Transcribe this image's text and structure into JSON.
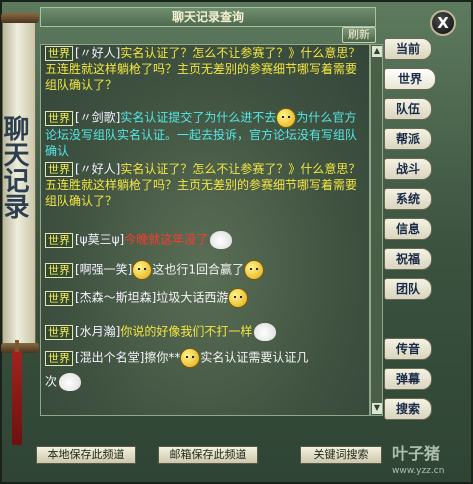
{
  "window": {
    "title": "聊天记录查询",
    "refresh_label": "刷新",
    "close_label": "X"
  },
  "scroll_banner": "聊天记录",
  "messages": [
    {
      "channel": "世界",
      "name": "[〃好人]",
      "text": "实名认证了？怎么不让参赛了？》什么意思？五连胜就这样躺枪了吗？主页无差别的参赛细节哪写着需要组队确认了？",
      "color": "yellow"
    },
    {
      "channel": "世界",
      "name": "[〃剑歌]",
      "text": "实名认证提交了为什么进不去",
      "text2": "为什么官方论坛没写组队实名认证。一起去投诉，官方论坛没有写组队确认",
      "color": "cyan"
    },
    {
      "channel": "世界",
      "name": "[〃好人]",
      "text": "实名认证了？怎么不让参赛了？》什么意思？五连胜就这样躺枪了吗？主页无差别的参赛细节哪写着需要组队确认了？",
      "color": "yellow"
    },
    {
      "channel": "世界",
      "name": "[ψ莫三ψ]",
      "text": "今晚就这年没了",
      "color": "red"
    },
    {
      "channel": "世界",
      "name": "[啊强一笑]",
      "text": "这也行1回合赢了",
      "color": "white"
    },
    {
      "channel": "世界",
      "name": "[杰森～斯坦森]",
      "text": "垃圾大话西游",
      "color": "white"
    },
    {
      "channel": "世界",
      "name": "[水月瀚]",
      "text": "你说的好像我们不打一样",
      "color": "yellow"
    },
    {
      "channel": "世界",
      "name": "[混出个名堂]",
      "text": "擦你**",
      "text2": "实名认证需要认证几",
      "text3": "次",
      "color": "white"
    }
  ],
  "tabs": [
    {
      "label": "当前"
    },
    {
      "label": "世界"
    },
    {
      "label": "队伍"
    },
    {
      "label": "帮派"
    },
    {
      "label": "战斗"
    },
    {
      "label": "系统"
    },
    {
      "label": "信息"
    },
    {
      "label": "祝福"
    },
    {
      "label": "团队"
    },
    {
      "label": "传音"
    },
    {
      "label": "弹幕"
    },
    {
      "label": "搜索"
    }
  ],
  "bottom_buttons": {
    "local_save": "本地保存此频道",
    "mail_save": "邮箱保存此频道",
    "keyword": "关键词搜索"
  },
  "watermark": {
    "brand": "叶子猪",
    "url": "www.yzz.cn"
  },
  "colors": {
    "channel_badge": "#ffe85c",
    "yellow_text": "#f4e640",
    "cyan_text": "#54e8e6",
    "red_text": "#ff3a2e",
    "panel_green": "#3f5240"
  }
}
